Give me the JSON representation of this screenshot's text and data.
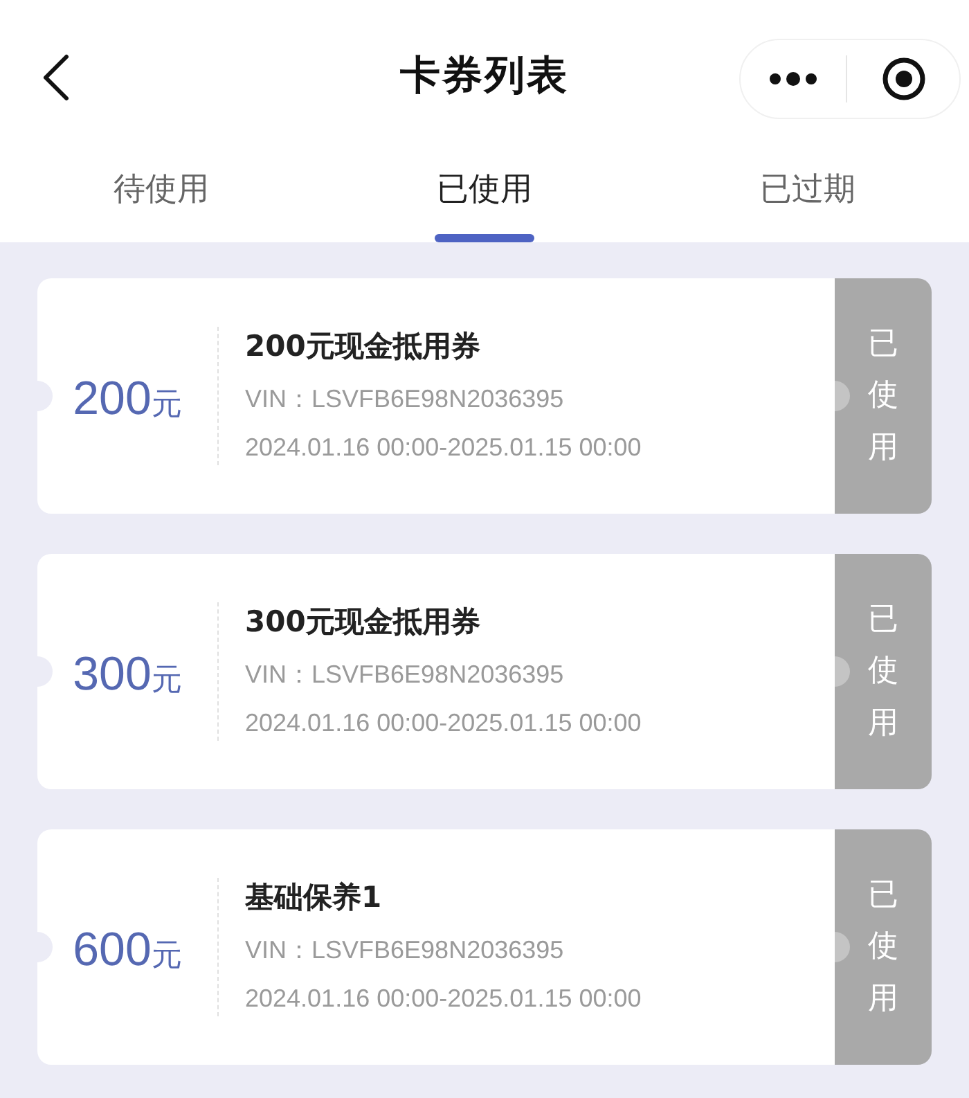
{
  "header": {
    "title": "卡券列表"
  },
  "tabs": [
    {
      "label": "待使用",
      "selected": false
    },
    {
      "label": "已使用",
      "selected": true
    },
    {
      "label": "已过期",
      "selected": false
    }
  ],
  "coupons": [
    {
      "amount": "200",
      "unit": "元",
      "title": "200元现金抵用券",
      "vin": "VIN：LSVFB6E98N2036395",
      "period": "2024.01.16 00:00-2025.01.15 00:00",
      "status": "已使用"
    },
    {
      "amount": "300",
      "unit": "元",
      "title": "300元现金抵用券",
      "vin": "VIN：LSVFB6E98N2036395",
      "period": "2024.01.16 00:00-2025.01.15 00:00",
      "status": "已使用"
    },
    {
      "amount": "600",
      "unit": "元",
      "title": "基础保养1",
      "vin": "VIN：LSVFB6E98N2036395",
      "period": "2024.01.16 00:00-2025.01.15 00:00",
      "status": "已使用"
    }
  ]
}
